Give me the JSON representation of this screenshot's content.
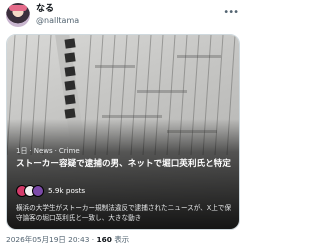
{
  "author": {
    "display_name": "なる",
    "handle": "@nalltama",
    "avatar_icon": "avatar-anime-character"
  },
  "more_icon": "more-horizontal-icon",
  "card": {
    "image_description_icon": "newspaper-clipping-image",
    "meta": {
      "time": "1日",
      "separator": "·",
      "category": "News",
      "subcategory": "Crime"
    },
    "headline": "ストーカー容疑で逮捕の男、ネットで堀口英利氏と特定",
    "posts_count": "5.9k posts",
    "summary": "横浜の大学生がストーカー規制法違反で逮捕されたニュースが、X上で保守論客の堀口英利氏と一致し、大きな動き"
  },
  "footer": {
    "timestamp": "2026年05月19日 20:43",
    "separator": "·",
    "views_count": "160",
    "views_label": "表示"
  },
  "colors": {
    "text_primary": "#0f1419",
    "text_secondary": "#536471",
    "card_border": "#cfd9de"
  }
}
